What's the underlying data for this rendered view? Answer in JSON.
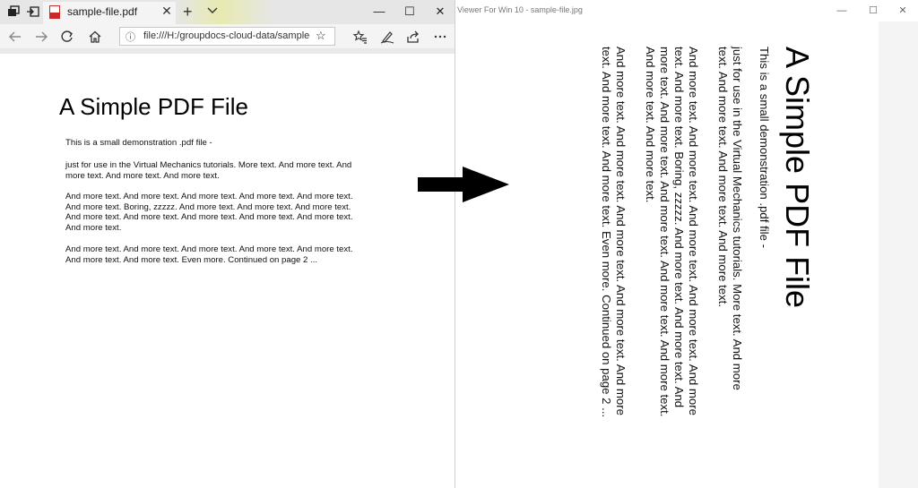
{
  "browser": {
    "tab_title": "sample-file.pdf",
    "tab_close": "✕",
    "new_tab": "+",
    "address_url": "file:///H:/groupdocs-cloud-data/sample-file.pdf",
    "window_controls": {
      "minimize": "—",
      "maximize": "☐",
      "close": "✕"
    },
    "icons": [
      "tab-manager-icon",
      "set-tabs-aside-icon",
      "pdf-file-icon",
      "back-arrow-icon",
      "forward-arrow-icon",
      "refresh-icon",
      "home-icon",
      "info-icon",
      "favorite-star-icon",
      "favorites-hub-icon",
      "pen-icon",
      "share-icon",
      "more-icon"
    ]
  },
  "pdf": {
    "title": "A Simple PDF File",
    "p1": "This is a small demonstration .pdf file -",
    "p2": "just for use in the Virtual Mechanics tutorials. More text. And more text. And more text. And more text. And more text.",
    "p3": "And more text. And more text. And more text. And more text. And more text. And more text. Boring, zzzzz. And more text. And more text. And more text. And more text. And more text. And more text. And more text. And more text. And more text.",
    "p4": "And more text. And more text. And more text. And more text. And more text. And more text. And more text. Even more. Continued on page 2 ..."
  },
  "viewer": {
    "title": "Viewer For Win 10 - sample-file.jpg",
    "window_controls": {
      "minimize": "—",
      "maximize": "☐",
      "close": "✕"
    },
    "rotated_image": {
      "title": "A Simple PDF File",
      "lines": [
        "This is a small demonstration .pdf file -",
        "just for use in the Virtual Mechanics tutorials. More text. And more",
        "text. And more text. And more text. And more text.",
        "And more text. And more text. And more text. And more text. And more",
        "text. And more text. Boring, zzzzz. And more text. And more text. And",
        "more text. And more text. And more text. And more text. And more text.",
        "And more text. And more text.",
        "And more text. And more text. And more text. And more text. And more",
        "text. And more text. And more text. Even more. Continued on page 2 ..."
      ]
    }
  },
  "colors": {
    "titlebar": "#e6e6e6",
    "toolbar": "#f4f4f4",
    "pdf_red": "#c72b2b",
    "arrow": "#000000"
  }
}
